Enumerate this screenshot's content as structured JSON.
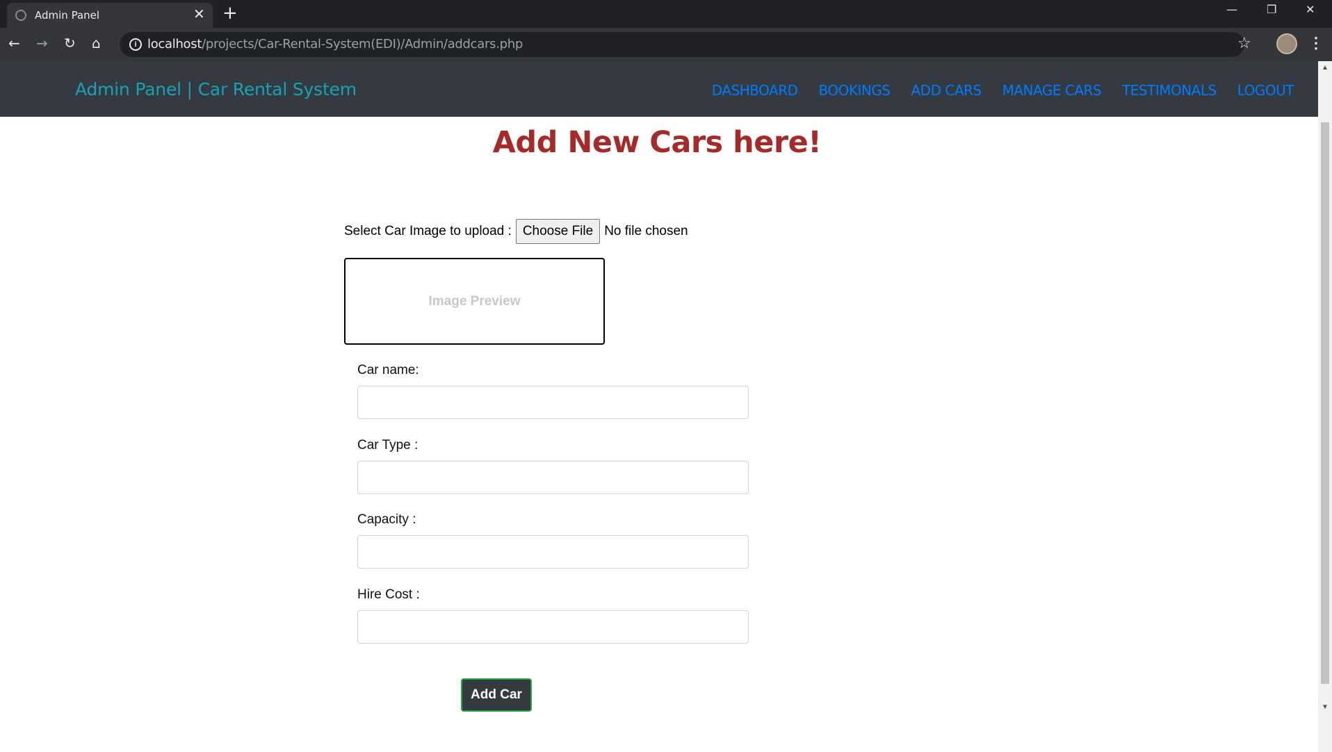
{
  "browser": {
    "tab_title": "Admin Panel",
    "tab_close": "✕",
    "new_tab": "+",
    "url_host": "localhost",
    "url_path": "/projects/Car-Rental-System(EDI)/Admin/addcars.php",
    "window_controls": [
      "—",
      "❐",
      "✕"
    ]
  },
  "navbar": {
    "brand": "Admin Panel | Car Rental System",
    "links": [
      "DASHBOARD",
      "BOOKINGS",
      "ADD CARS",
      "MANAGE CARS",
      "TESTIMONALS",
      "LOGOUT"
    ]
  },
  "main": {
    "heading": "Add New Cars here!",
    "upload_label": "Select Car Image to upload :",
    "choose_file": "Choose File",
    "no_file": "No file chosen",
    "preview_text": "Image Preview",
    "fields": [
      {
        "label": "Car name:",
        "value": ""
      },
      {
        "label": "Car Type :",
        "value": ""
      },
      {
        "label": "Capacity :",
        "value": ""
      },
      {
        "label": "Hire Cost :",
        "value": ""
      }
    ],
    "submit": "Add Car"
  },
  "colors": {
    "navbar_bg": "#343a40",
    "brand": "#17a2b8",
    "nav_link": "#007bff",
    "heading": "#a52a2a",
    "button_border": "#28a745"
  }
}
